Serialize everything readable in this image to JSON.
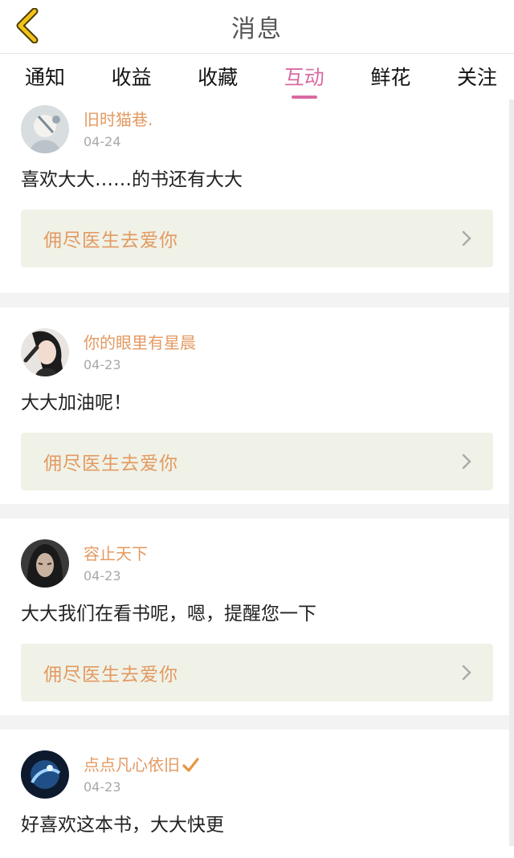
{
  "header": {
    "title": "消息"
  },
  "tabs": [
    {
      "label": "通知"
    },
    {
      "label": "收益"
    },
    {
      "label": "收藏"
    },
    {
      "label": "互动",
      "active": true
    },
    {
      "label": "鲜花"
    },
    {
      "label": "关注"
    }
  ],
  "messages": [
    {
      "username": "旧时猫巷.",
      "date": "04-24",
      "comment": "喜欢大大……的书还有大大",
      "book_title": "佣尽医生去爱你",
      "verified": false
    },
    {
      "username": "你的眼里有星晨",
      "date": "04-23",
      "comment": "大大加油呢！",
      "book_title": "佣尽医生去爱你",
      "verified": false
    },
    {
      "username": "容止天下",
      "date": "04-23",
      "comment": "大大我们在看书呢，嗯，提醒您一下",
      "book_title": "佣尽医生去爱你",
      "verified": false
    },
    {
      "username": "点点凡心依旧",
      "date": "04-23",
      "comment": "好喜欢这本书，大大快更",
      "book_title": "",
      "verified": true
    }
  ],
  "colors": {
    "accent_tab": "#d96aa2",
    "username": "#e39a62",
    "book_bg": "#f0f2e8",
    "back_arrow": "#f1c21b"
  },
  "icons": {
    "back": "chevron-left-icon",
    "book_arrow": "chevron-right-icon",
    "verified": "check-icon"
  }
}
